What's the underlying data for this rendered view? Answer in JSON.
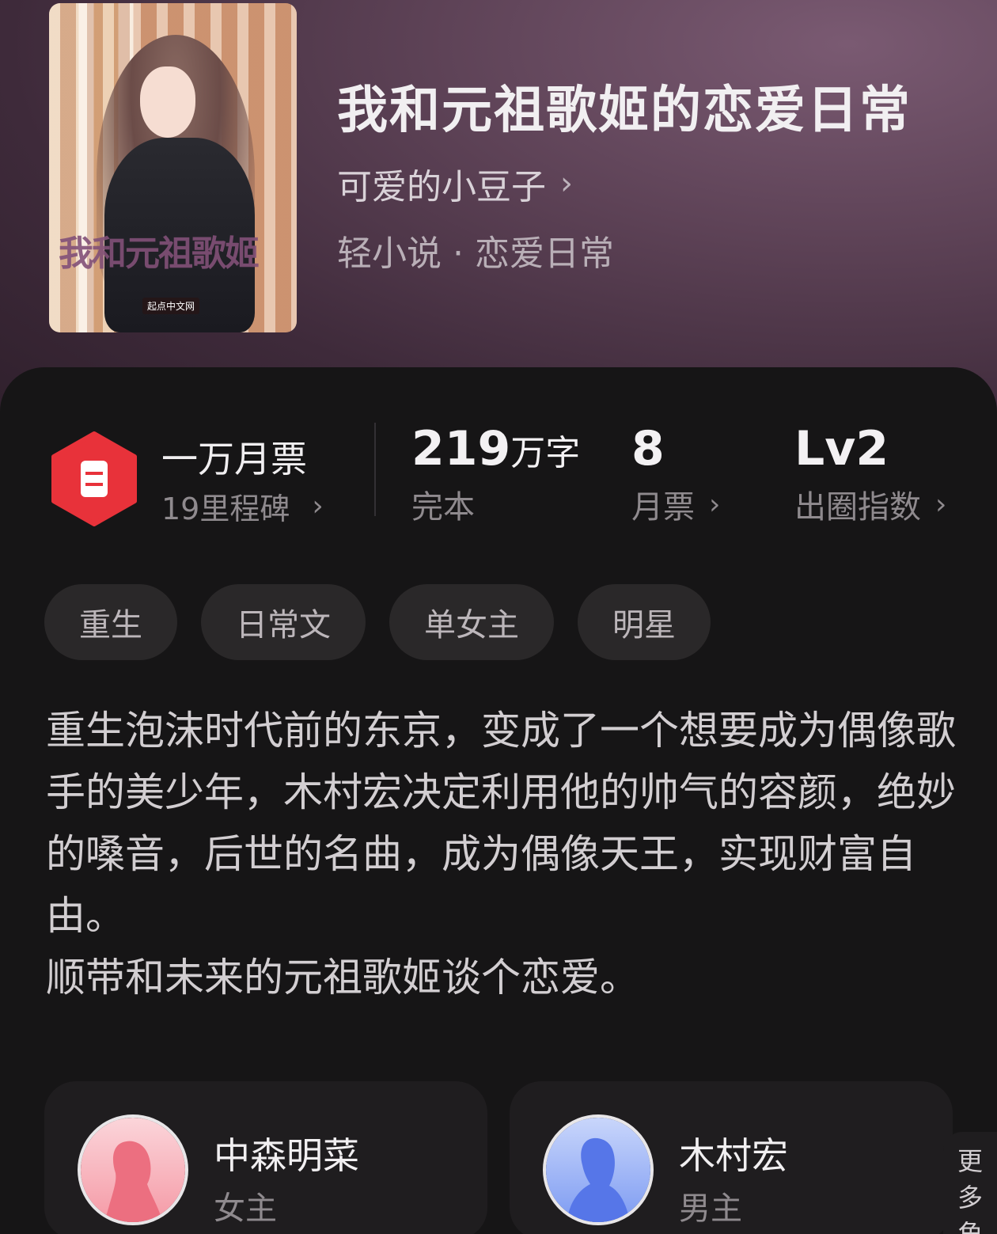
{
  "book": {
    "title": "我和元祖歌姬的恋爱日常",
    "author": "可爱的小豆子",
    "author_chevron": "›",
    "genre": "轻小说 · 恋爱日常",
    "cover": {
      "title_text": "我和元祖歌姬",
      "publisher_badge": "起点中文网"
    }
  },
  "milestone": {
    "title": "一万月票",
    "subtitle": "19里程碑",
    "icon": "ticket-icon",
    "icon_color": "#e8323a"
  },
  "stats": [
    {
      "value": "219",
      "unit": "万字",
      "label": "完本"
    },
    {
      "value": "8",
      "unit": "",
      "label": "月票"
    },
    {
      "value": "Lv2",
      "unit": "",
      "label": "出圈指数"
    }
  ],
  "tags": [
    "重生",
    "日常文",
    "单女主",
    "明星"
  ],
  "description": [
    "重生泡沫时代前的东京，变成了一个想要成为偶像歌手的美少年，木村宏决定利用他的帅气的容颜，绝妙的嗓音，后世的名曲，成为偶像天王，实现财富自由。",
    "顺带和未来的元祖歌姬谈个恋爱。"
  ],
  "characters": [
    {
      "name": "中森明菜",
      "role": "女主",
      "avatar_color": "#f07a8a"
    },
    {
      "name": "木村宏",
      "role": "男主",
      "avatar_color": "#6a8df2"
    }
  ],
  "more_tab": [
    "更",
    "多",
    "角"
  ],
  "chevron": "›"
}
